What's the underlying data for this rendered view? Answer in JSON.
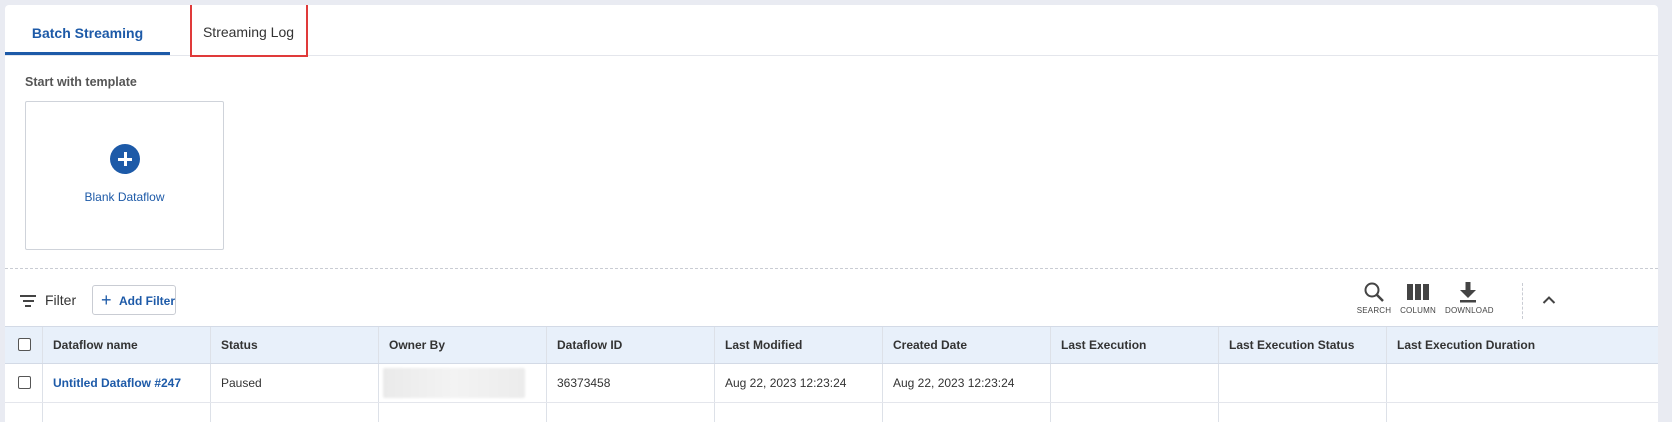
{
  "tabs": [
    {
      "label": "Batch Streaming",
      "active": true
    },
    {
      "label": "Streaming Log",
      "active": false
    }
  ],
  "template": {
    "title": "Start with template",
    "blank_label": "Blank Dataflow"
  },
  "filter": {
    "label": "Filter",
    "add_label": "Add Filter"
  },
  "toolbar": {
    "search_label": "SEARCH",
    "column_label": "COLUMN",
    "download_label": "DOWNLOAD"
  },
  "table": {
    "columns": [
      "Dataflow name",
      "Status",
      "Owner By",
      "Dataflow ID",
      "Last Modified",
      "Created Date",
      "Last Execution",
      "Last Execution Status",
      "Last Execution Duration"
    ],
    "rows": [
      {
        "name": "Untitled Dataflow #247",
        "status": "Paused",
        "owner": "",
        "id": "36373458",
        "last_modified": "Aug 22, 2023 12:23:24",
        "created": "Aug 22, 2023 12:23:24",
        "last_execution": "",
        "last_execution_status": "",
        "last_execution_duration": ""
      }
    ]
  },
  "colors": {
    "accent": "#1d5aa8",
    "highlight": "#e03a3a",
    "header_bg": "#e8f0fa"
  }
}
